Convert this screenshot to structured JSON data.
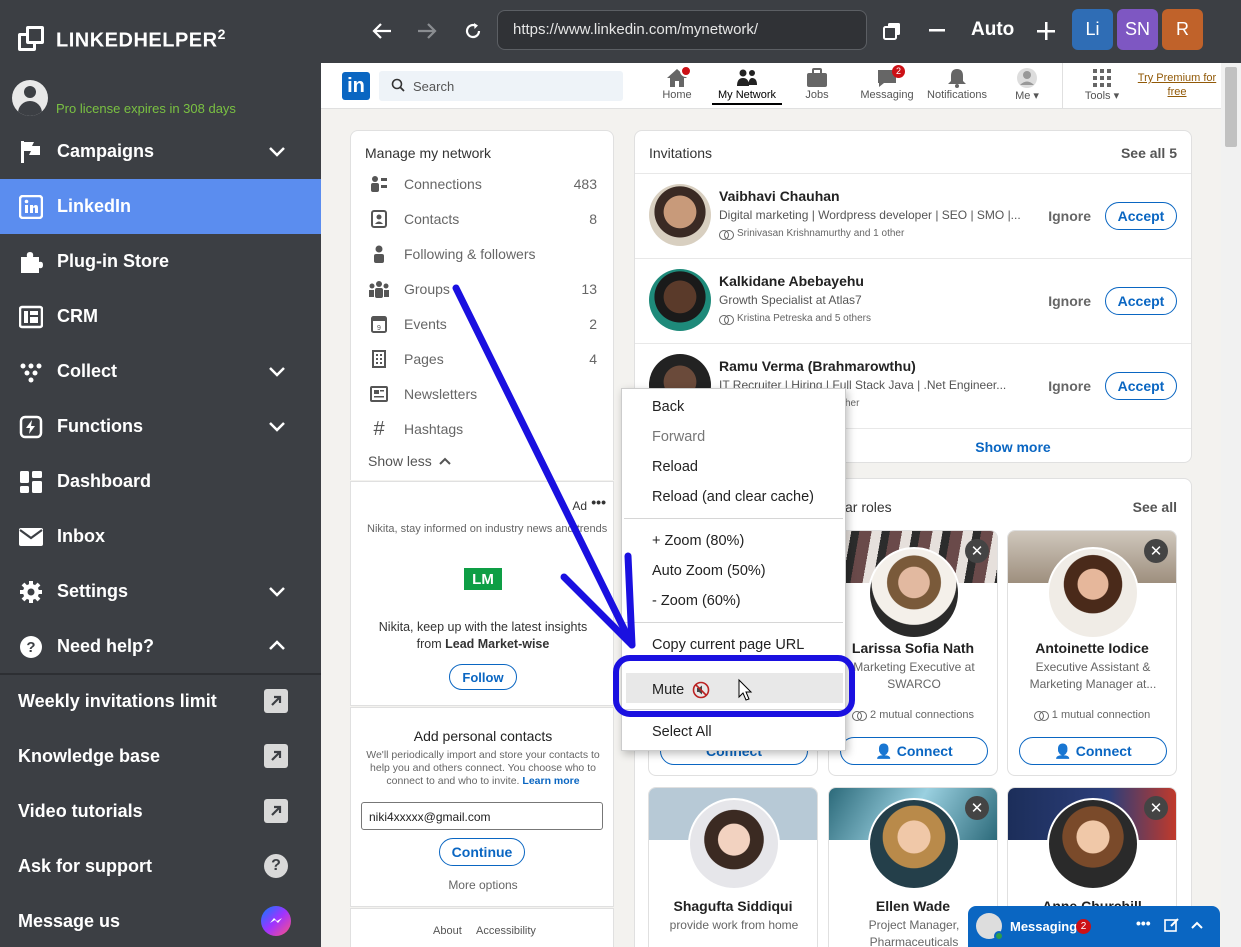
{
  "sidebar": {
    "brand": "LINKEDHELPER",
    "brand_sup": "2",
    "license": "Pro license expires in 308 days",
    "items": [
      {
        "label": "Campaigns",
        "icon": "flag-icon",
        "chevron": "down"
      },
      {
        "label": "LinkedIn",
        "icon": "linkedin-icon",
        "active": true
      },
      {
        "label": "Plug-in Store",
        "icon": "puzzle-icon"
      },
      {
        "label": "CRM",
        "icon": "crm-icon"
      },
      {
        "label": "Collect",
        "icon": "collect-icon",
        "chevron": "down"
      },
      {
        "label": "Functions",
        "icon": "functions-icon",
        "chevron": "down"
      },
      {
        "label": "Dashboard",
        "icon": "dashboard-icon"
      },
      {
        "label": "Inbox",
        "icon": "envelope-icon"
      },
      {
        "label": "Settings",
        "icon": "gear-icon",
        "chevron": "down"
      },
      {
        "label": "Need help?",
        "icon": "question-icon",
        "chevron": "up"
      }
    ],
    "links": [
      {
        "label": "Weekly invitations limit",
        "icon": "external-link-icon"
      },
      {
        "label": "Knowledge base",
        "icon": "external-link-icon"
      },
      {
        "label": "Video tutorials",
        "icon": "external-link-icon"
      },
      {
        "label": "Ask for support",
        "icon": "help-bubble-icon"
      },
      {
        "label": "Message us",
        "icon": "messenger-icon"
      }
    ]
  },
  "browser": {
    "url": "https://www.linkedin.com/mynetwork/",
    "zoom": "Auto",
    "profiles": [
      {
        "label": "Li",
        "color": "#2f6db5"
      },
      {
        "label": "SN",
        "color": "#7e57c2"
      },
      {
        "label": "R",
        "color": "#c0622a"
      }
    ]
  },
  "linkedin": {
    "search_placeholder": "Search",
    "nav": [
      {
        "label": "Home",
        "icon": "home-icon",
        "badge": ""
      },
      {
        "label": "My Network",
        "icon": "network-icon",
        "active": true
      },
      {
        "label": "Jobs",
        "icon": "briefcase-icon"
      },
      {
        "label": "Messaging",
        "icon": "messaging-icon",
        "badge": "2"
      },
      {
        "label": "Notifications",
        "icon": "bell-icon"
      },
      {
        "label": "Me",
        "icon": "me-avatar-icon"
      },
      {
        "label": "Tools",
        "icon": "grid-icon"
      }
    ],
    "premium": "Try Premium for free",
    "manage": {
      "title": "Manage my network",
      "rows": [
        {
          "label": "Connections",
          "count": "483",
          "icon": "connections-icon"
        },
        {
          "label": "Contacts",
          "count": "8",
          "icon": "contacts-icon"
        },
        {
          "label": "Following & followers",
          "count": "",
          "icon": "person-icon"
        },
        {
          "label": "Groups",
          "count": "13",
          "icon": "groups-icon"
        },
        {
          "label": "Events",
          "count": "2",
          "icon": "calendar-icon"
        },
        {
          "label": "Pages",
          "count": "4",
          "icon": "building-icon"
        },
        {
          "label": "Newsletters",
          "count": "",
          "icon": "newspaper-icon"
        },
        {
          "label": "Hashtags",
          "count": "",
          "icon": "hashtag-icon"
        }
      ],
      "show_less": "Show less"
    },
    "ad": {
      "tag": "Ad",
      "line1": "Nikita, stay informed on industry news and trends",
      "logo": "LM",
      "line2a": "Nikita, keep up with the latest insights",
      "line2b_pre": "from ",
      "line2b_bold": "Lead Market-wise",
      "follow": "Follow"
    },
    "contacts": {
      "title": "Add personal contacts",
      "desc": "We'll periodically import and store your contacts to help you and others connect. You choose who to connect to and who to invite.",
      "learn": "Learn more",
      "email": "niki4xxxxx@gmail.com",
      "continue": "Continue",
      "more": "More options"
    },
    "footer": {
      "about": "About",
      "accessibility": "Accessibility"
    },
    "invitations": {
      "title": "Invitations",
      "see_all": "See all 5",
      "ignore": "Ignore",
      "accept": "Accept",
      "show_more": "Show more",
      "items": [
        {
          "name": "Vaibhavi Chauhan",
          "headline": "Digital marketing | Wordpress developer | SEO | SMO |...",
          "mutual": "Srinivasan Krishnamurthy and 1 other"
        },
        {
          "name": "Kalkidane Abebayehu",
          "headline": "Growth Specialist at Atlas7",
          "mutual": "Kristina Petreska and 5 others"
        },
        {
          "name": "Ramu Verma (Brahmarowthu)",
          "headline": "IT Recruiter | Hiring | Full Stack Java | .Net Engineer...",
          "mutual": "her"
        }
      ]
    },
    "suggest": {
      "title_tail": "ar roles",
      "see_all": "See all",
      "connect": "Connect",
      "people": [
        {
          "name": "",
          "sub": "",
          "mutual": ""
        },
        {
          "name": "Larissa Sofia Nath",
          "sub": "Marketing Executive at SWARCO",
          "mutual": "2 mutual connections"
        },
        {
          "name": "Antoinette Iodice",
          "sub": "Executive Assistant & Marketing Manager at...",
          "mutual": "1 mutual connection"
        },
        {
          "name": "Shagufta Siddiqui",
          "sub": "provide work from home",
          "mutual": ""
        },
        {
          "name": "Ellen Wade",
          "sub": "Project Manager, Pharmaceuticals",
          "mutual": ""
        },
        {
          "name": "Anne Churchill",
          "sub": "",
          "mutual": ""
        }
      ]
    },
    "messaging": {
      "label": "Messaging",
      "badge": "2"
    }
  },
  "context_menu": {
    "items": [
      "Back",
      "Forward",
      "Reload",
      "Reload (and clear cache)",
      "+ Zoom (80%)",
      "Auto Zoom (50%)",
      "- Zoom (60%)",
      "Copy current page URL",
      "Mute",
      "Select All"
    ]
  },
  "colors": {
    "sidebar_bg": "#3c3f44",
    "sidebar_active": "#5b8def",
    "license_green": "#7ac142",
    "linkedin_blue": "#0a66c2",
    "annotation_blue": "#1a10e0"
  }
}
